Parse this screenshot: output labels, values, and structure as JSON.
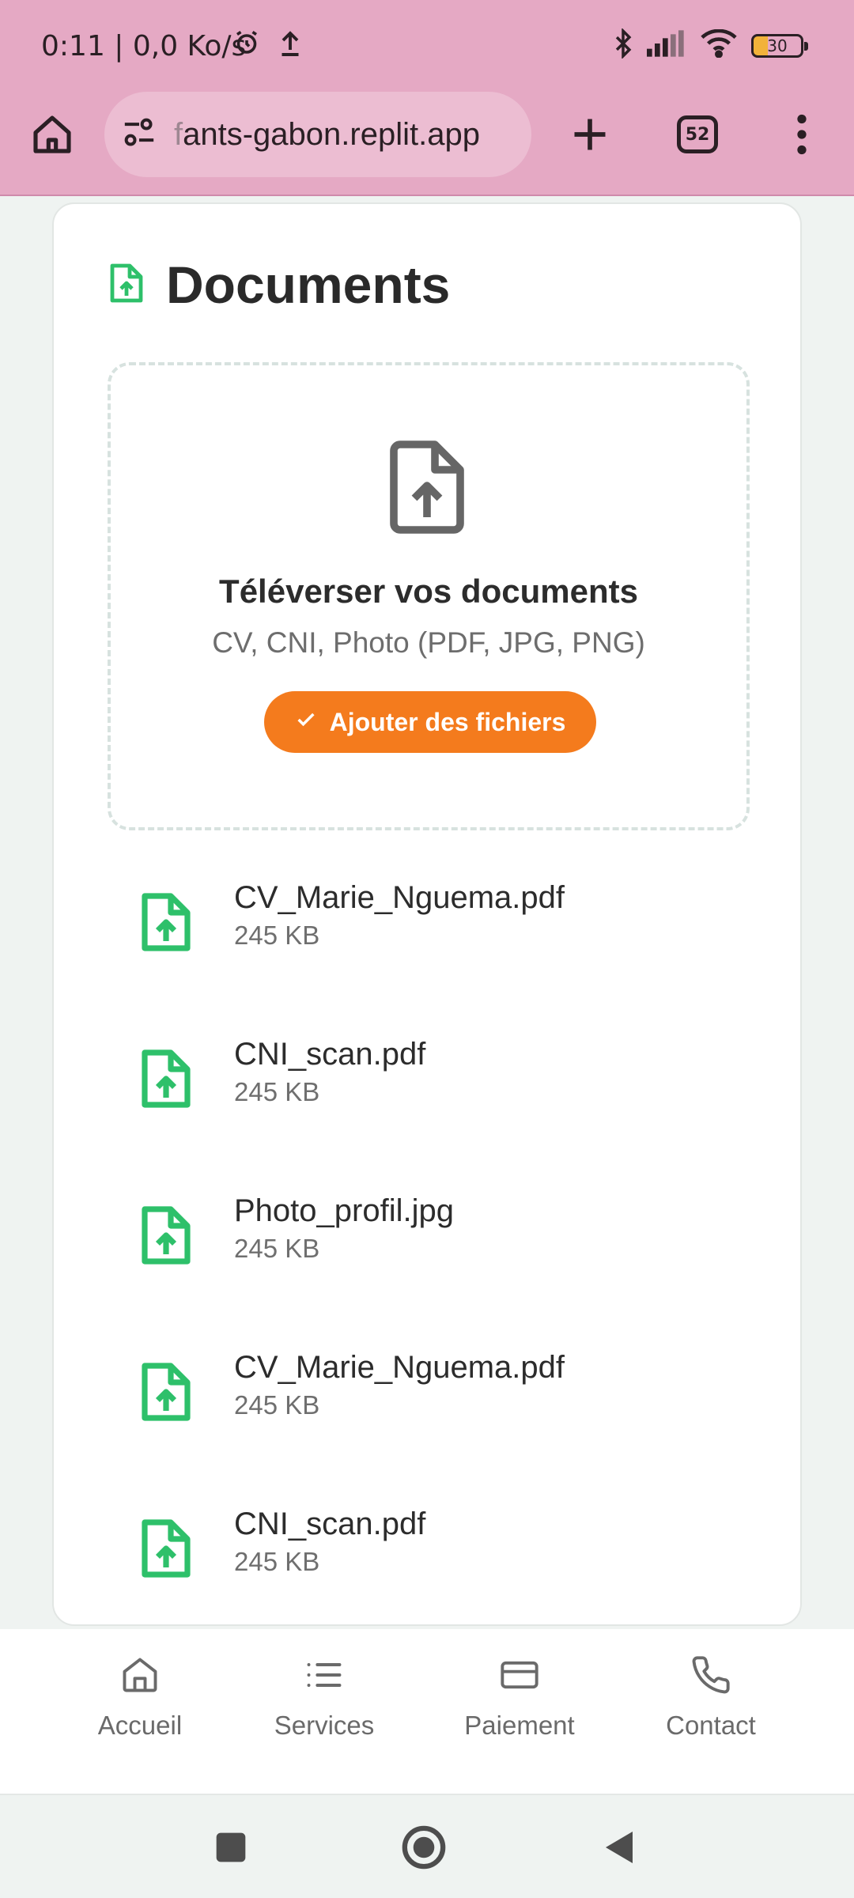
{
  "status": {
    "time": "0:11 | 0,0 Ko/s",
    "battery": "30"
  },
  "browser": {
    "url_faded": "f",
    "url_rest": "ants-gabon.replit.app",
    "tab_count": "52"
  },
  "documents": {
    "title": "Documents",
    "upload_title": "Téléverser vos documents",
    "upload_subtitle": "CV, CNI, Photo (PDF, JPG, PNG)",
    "add_button": "Ajouter des fichiers",
    "files": [
      {
        "name": "CV_Marie_Nguema.pdf",
        "size": "245 KB"
      },
      {
        "name": "CNI_scan.pdf",
        "size": "245 KB"
      },
      {
        "name": "Photo_profil.jpg",
        "size": "245 KB"
      },
      {
        "name": "CV_Marie_Nguema.pdf",
        "size": "245 KB"
      },
      {
        "name": "CNI_scan.pdf",
        "size": "245 KB"
      }
    ]
  },
  "nav": {
    "items": [
      {
        "label": "Accueil",
        "icon": "home-icon"
      },
      {
        "label": "Services",
        "icon": "list-icon"
      },
      {
        "label": "Paiement",
        "icon": "card-icon"
      },
      {
        "label": "Contact",
        "icon": "phone-icon"
      }
    ]
  },
  "colors": {
    "chrome": "#e5a9c4",
    "accent_orange": "#f47b1d",
    "file_green": "#2ec06a"
  }
}
